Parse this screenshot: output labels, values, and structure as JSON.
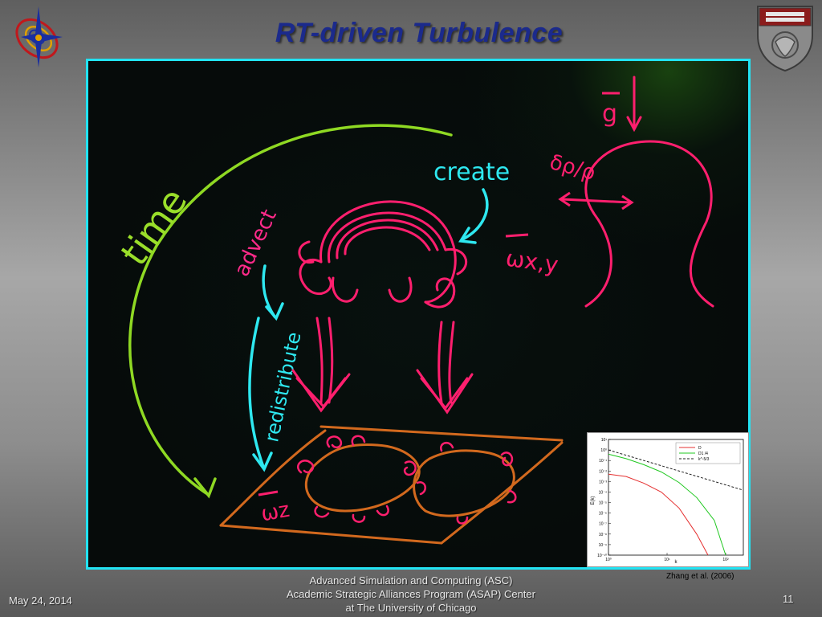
{
  "slide": {
    "title": "RT-driven Turbulence",
    "footer_lines": [
      "Advanced Simulation and Computing (ASC)",
      "Academic Strategic Alliances Program (ASAP) Center",
      "at The University of Chicago"
    ],
    "date": "May 24, 2014",
    "page_number": "11"
  },
  "board": {
    "label_time": "time",
    "label_create": "create",
    "label_advect": "advect",
    "label_redistribute": "redistribute",
    "label_g": "g",
    "label_drho": "δρ/ρ",
    "label_omega_xy": "ωx,y",
    "label_omega_z": "ωz",
    "colors": {
      "board_border": "#22e3f3",
      "pink": "#ff1f6e",
      "cyan": "#2ee8f0",
      "green": "#9adf2a",
      "orange": "#d2691e"
    }
  },
  "inset": {
    "citation": "Zhang et al. (2006)",
    "chart_data": {
      "type": "line",
      "xlabel": "k",
      "ylabel": "E(k)",
      "xscale": "log",
      "yscale": "log",
      "xlim": [
        1,
        200
      ],
      "ylim": [
        1e-10,
        10
      ],
      "x_ticks": [
        "10⁰",
        "10¹",
        "10²"
      ],
      "y_ticks": [
        "10¹",
        "10⁰",
        "10⁻¹",
        "10⁻²",
        "10⁻³",
        "10⁻⁴",
        "10⁻⁵",
        "10⁻⁶",
        "10⁻⁷",
        "10⁻⁸",
        "10⁻⁹",
        "10⁻¹⁰"
      ],
      "series": [
        {
          "name": "D",
          "color": "#e53030",
          "x": [
            1,
            2,
            4,
            8,
            16,
            32,
            50
          ],
          "y": [
            0.005,
            0.003,
            0.0007,
            0.0001,
            3e-06,
            1e-08,
            1e-10
          ]
        },
        {
          "name": "D1 /4",
          "color": "#21c821",
          "x": [
            1,
            2,
            4,
            8,
            16,
            32,
            64,
            100
          ],
          "y": [
            0.4,
            0.15,
            0.04,
            0.008,
            0.0008,
            3e-05,
            2e-07,
            1e-10
          ]
        },
        {
          "name": "k^-5/3",
          "color": "#222222",
          "dashed": true,
          "x": [
            1,
            200
          ],
          "y": [
            1.0,
            0.00015
          ]
        }
      ],
      "legend_position": "top-right"
    }
  }
}
